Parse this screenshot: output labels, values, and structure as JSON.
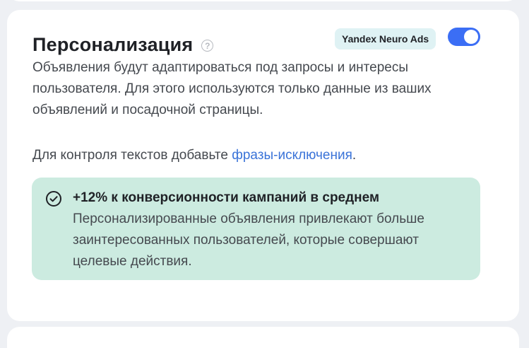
{
  "section": {
    "title": "Персонализация",
    "help_icon": "question-circle-icon",
    "badge_label": "Yandex Neuro Ads",
    "toggle_on": true,
    "description": "Объявления будут адаптироваться под запросы и интересы пользователя. Для этого используются только данные из ваших объявлений и посадочной страницы.",
    "control_prefix": "Для контроля текстов добавьте ",
    "control_link": "фразы-исключения",
    "control_suffix": "."
  },
  "info": {
    "icon": "check-circle-icon",
    "title": "+12% к конверсионности кампаний в среднем",
    "text": "Персонализированные объявления привлекают больше заинтересованных пользователей, которые совершают целевые действия."
  },
  "colors": {
    "toggle_on": "#3b6ef5",
    "badge_bg": "#dff2f4",
    "info_bg": "#ccebe0",
    "link": "#3a73d8"
  }
}
